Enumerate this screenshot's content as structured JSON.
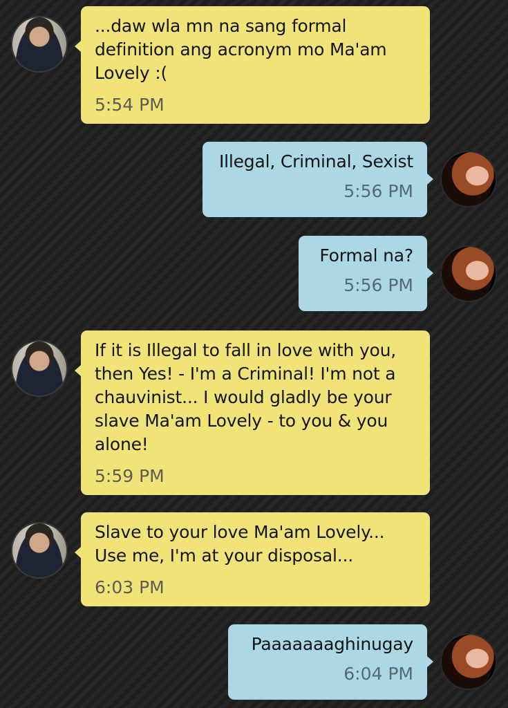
{
  "messages": [
    {
      "sender": "him",
      "text": "...daw wla mn na sang formal definition ang acronym mo Ma'am Lovely :(",
      "time": "5:54 PM"
    },
    {
      "sender": "her",
      "text": "Illegal, Criminal, Sexist",
      "time": "5:56 PM"
    },
    {
      "sender": "her",
      "text": "Formal na?",
      "time": "5:56 PM"
    },
    {
      "sender": "him",
      "text": "If it is Illegal to fall in love with you, then Yes! - I'm a Criminal! I'm not a chauvinist... I would gladly be your slave Ma'am Lovely - to you & you alone!",
      "time": "5:59 PM"
    },
    {
      "sender": "him",
      "text": "Slave to your love Ma'am Lovely... Use me, I'm at your disposal...",
      "time": "6:03 PM"
    },
    {
      "sender": "her",
      "text": "Paaaaaaaghinugay",
      "time": "6:04 PM"
    }
  ],
  "colors": {
    "incoming_bubble": "#f0e478",
    "outgoing_bubble": "#acd8e5",
    "background": "#232323"
  }
}
